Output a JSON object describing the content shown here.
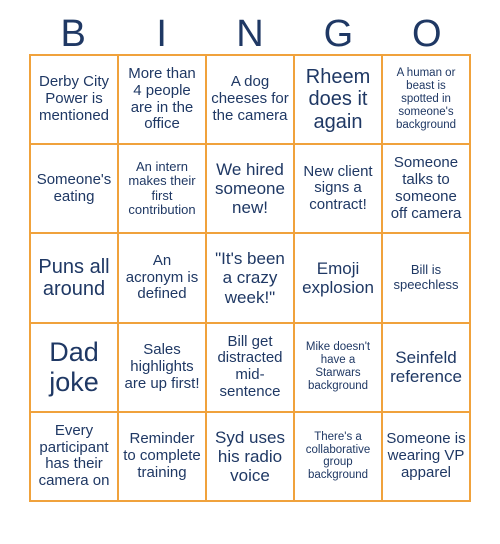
{
  "card": {
    "title_letters": [
      "B",
      "I",
      "N",
      "G",
      "O"
    ],
    "accent_border_color": "#f0a23c",
    "text_color": "#1f3864",
    "background_color": "#ffffff",
    "columns": 5,
    "rows": 5,
    "cells": [
      {
        "text": "Derby City Power is mentioned",
        "size": "fs-m"
      },
      {
        "text": "More than 4 people are in the office",
        "size": "fs-m"
      },
      {
        "text": "A dog cheeses for the camera",
        "size": "fs-m"
      },
      {
        "text": "Rheem does it again",
        "size": "fs-xl"
      },
      {
        "text": "A human or beast is spotted in someone's background",
        "size": "fs-xs"
      },
      {
        "text": "Someone's eating",
        "size": "fs-m"
      },
      {
        "text": "An intern makes their first contribution",
        "size": "fs-s"
      },
      {
        "text": "We hired someone new!",
        "size": "fs-l"
      },
      {
        "text": "New client signs a contract!",
        "size": "fs-m"
      },
      {
        "text": "Someone talks to someone off camera",
        "size": "fs-m"
      },
      {
        "text": "Puns all around",
        "size": "fs-xl"
      },
      {
        "text": "An acronym is defined",
        "size": "fs-m"
      },
      {
        "text": "\"It's been a crazy week!\"",
        "size": "fs-l"
      },
      {
        "text": "Emoji explosion",
        "size": "fs-l"
      },
      {
        "text": "Bill is speechless",
        "size": "fs-s"
      },
      {
        "text": "Dad joke",
        "size": "fs-xxl"
      },
      {
        "text": "Sales highlights are up first!",
        "size": "fs-m"
      },
      {
        "text": "Bill get distracted mid-sentence",
        "size": "fs-m"
      },
      {
        "text": "Mike doesn't have a Starwars background",
        "size": "fs-xs"
      },
      {
        "text": "Seinfeld reference",
        "size": "fs-l"
      },
      {
        "text": "Every participant has their camera on",
        "size": "fs-m"
      },
      {
        "text": "Reminder to complete training",
        "size": "fs-m"
      },
      {
        "text": "Syd uses his radio voice",
        "size": "fs-l"
      },
      {
        "text": "There's a collaborative group background",
        "size": "fs-xs"
      },
      {
        "text": "Someone is wearing VP apparel",
        "size": "fs-m"
      }
    ]
  }
}
